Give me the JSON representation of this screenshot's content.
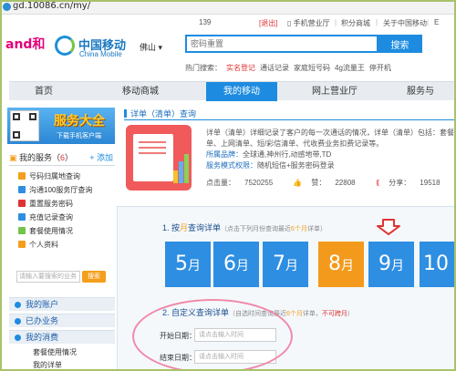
{
  "browser": {
    "url": "gd.10086.cn/my/"
  },
  "util": {
    "phone": "139",
    "logout": "[退出]",
    "hall": "手机营业厅",
    "points": "积分商城",
    "about": "关于中国移动",
    "english": "E"
  },
  "header": {
    "and_logo": "and和",
    "brand": "中国移动",
    "brand_en": "China Mobile",
    "city": "佛山",
    "search_placeholder": "密码重置",
    "search_label": "搜索",
    "hot_label": "热门搜索：",
    "hot_items": [
      "实名登记",
      "通话记录",
      "家庭短号码",
      "4g流量王",
      "停开机"
    ]
  },
  "nav": [
    "首页",
    "移动商城",
    "我的移动",
    "网上营业厅",
    "服务与"
  ],
  "sidebar": {
    "banner_big": "服务大全",
    "banner_small": "下载手机客户端",
    "my_services_label": "我的服务（",
    "my_services_count": "6",
    "my_services_close": "）",
    "add_label": "+ 添加",
    "services": [
      {
        "label": "号码归属地查询",
        "color": "#f59e1c"
      },
      {
        "label": "沟通100服务厅查询",
        "color": "#2e8ee2"
      },
      {
        "label": "重置服务密码",
        "color": "#e03131"
      },
      {
        "label": "充值记录查询",
        "color": "#2e8ee2"
      },
      {
        "label": "套餐使用情况",
        "color": "#74c34a"
      },
      {
        "label": "个人资料",
        "color": "#f59e1c"
      }
    ],
    "service_search_placeholder": "请输入要搜索的业务",
    "service_search_button": "搜索",
    "sections": [
      "我的账户",
      "已办业务",
      "我的消费"
    ],
    "subitems": [
      "套餐使用情况",
      "我的详单"
    ]
  },
  "product": {
    "crumb": "详单（清单）查询",
    "desc_line1": "详单（清单）详细记录了客户的每一次通话的情况，详单（清单）包括：套餐及固定费用详",
    "desc_line2": "单、上网清单、短/彩信清单、代收费业务扣费记录等。",
    "brand_label": "所属品牌：",
    "brand_value": "全球通,神州行,动感地带,TD",
    "mode_label": "服务模式权限：",
    "mode_value": "随机短信+服务密码登录",
    "clicks_label": "点击量：",
    "clicks": "7520255",
    "likes_label": "赞：",
    "likes": "22808",
    "shares_label": "分享：",
    "shares": "19518"
  },
  "query": {
    "step1_pre": "1. 按",
    "step1_hl": "月",
    "step1_post": "查询详单",
    "step1_note_pre": "（点击下列月份查询最近",
    "step1_note_hl": "6个月",
    "step1_note_post": "详单）",
    "months": [
      {
        "num": "5",
        "unit": "月",
        "selected": false
      },
      {
        "num": "6",
        "unit": "月",
        "selected": false
      },
      {
        "num": "7",
        "unit": "月",
        "selected": false
      },
      {
        "num": "8",
        "unit": "月",
        "selected": true
      },
      {
        "num": "9",
        "unit": "月",
        "selected": false
      },
      {
        "num": "10",
        "unit": "",
        "selected": false
      }
    ],
    "step2_title": "2. 自定义查询详单",
    "step2_note_pre": "（自选时间查询最近",
    "step2_note_hl": "6个月",
    "step2_note_post": "详单，",
    "step2_note_red": "不可跨月",
    "step2_note_close": "）",
    "start_label": "开始日期：",
    "end_label": "结束日期：",
    "date_placeholder": "请点击输入时间"
  }
}
